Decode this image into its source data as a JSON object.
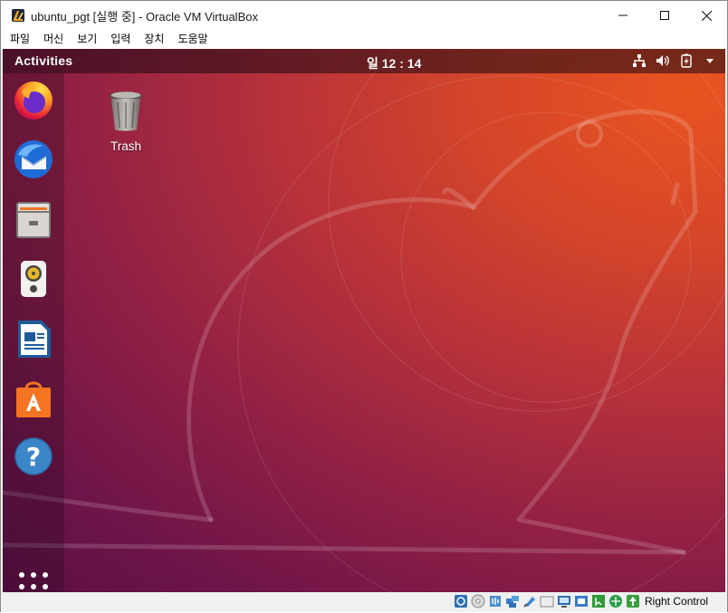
{
  "window": {
    "title": "ubuntu_pgt [실행 중] - Oracle VM VirtualBox",
    "controls": [
      "minimize",
      "maximize",
      "close"
    ]
  },
  "menubar": {
    "items": [
      {
        "label": "파일"
      },
      {
        "label": "머신"
      },
      {
        "label": "보기"
      },
      {
        "label": "입력"
      },
      {
        "label": "장치"
      },
      {
        "label": "도움말"
      }
    ]
  },
  "guest": {
    "topbar": {
      "activities_label": "Activities",
      "clock": "일 12 : 14",
      "tray_icons": [
        "network-icon",
        "volume-icon",
        "battery-icon",
        "system-menu-arrow-icon"
      ]
    },
    "dock": {
      "apps": [
        {
          "name": "firefox",
          "icon": "firefox-icon"
        },
        {
          "name": "thunderbird",
          "icon": "thunderbird-icon"
        },
        {
          "name": "files",
          "icon": "files-icon"
        },
        {
          "name": "rhythmbox",
          "icon": "rhythmbox-icon"
        },
        {
          "name": "libreoffice-writer",
          "icon": "writer-icon"
        },
        {
          "name": "ubuntu-software",
          "icon": "software-icon"
        },
        {
          "name": "help",
          "icon": "help-icon"
        }
      ],
      "show_apps_icon": "apps-grid-icon"
    },
    "desktop": {
      "trash_label": "Trash"
    },
    "colors": {
      "accent": "#e95420",
      "wallpaper_dark": "#5d0f45"
    }
  },
  "statusbar": {
    "host_key_label": "Right Control",
    "icons": [
      "hard-disk-icon",
      "optical-drive-icon",
      "audio-icon",
      "network-adapter-icon",
      "usb-icon",
      "shared-folders-icon",
      "display-icon",
      "recording-icon",
      "mouse-integration-icon",
      "cpu-icon",
      "host-key-arrow-icon"
    ]
  }
}
